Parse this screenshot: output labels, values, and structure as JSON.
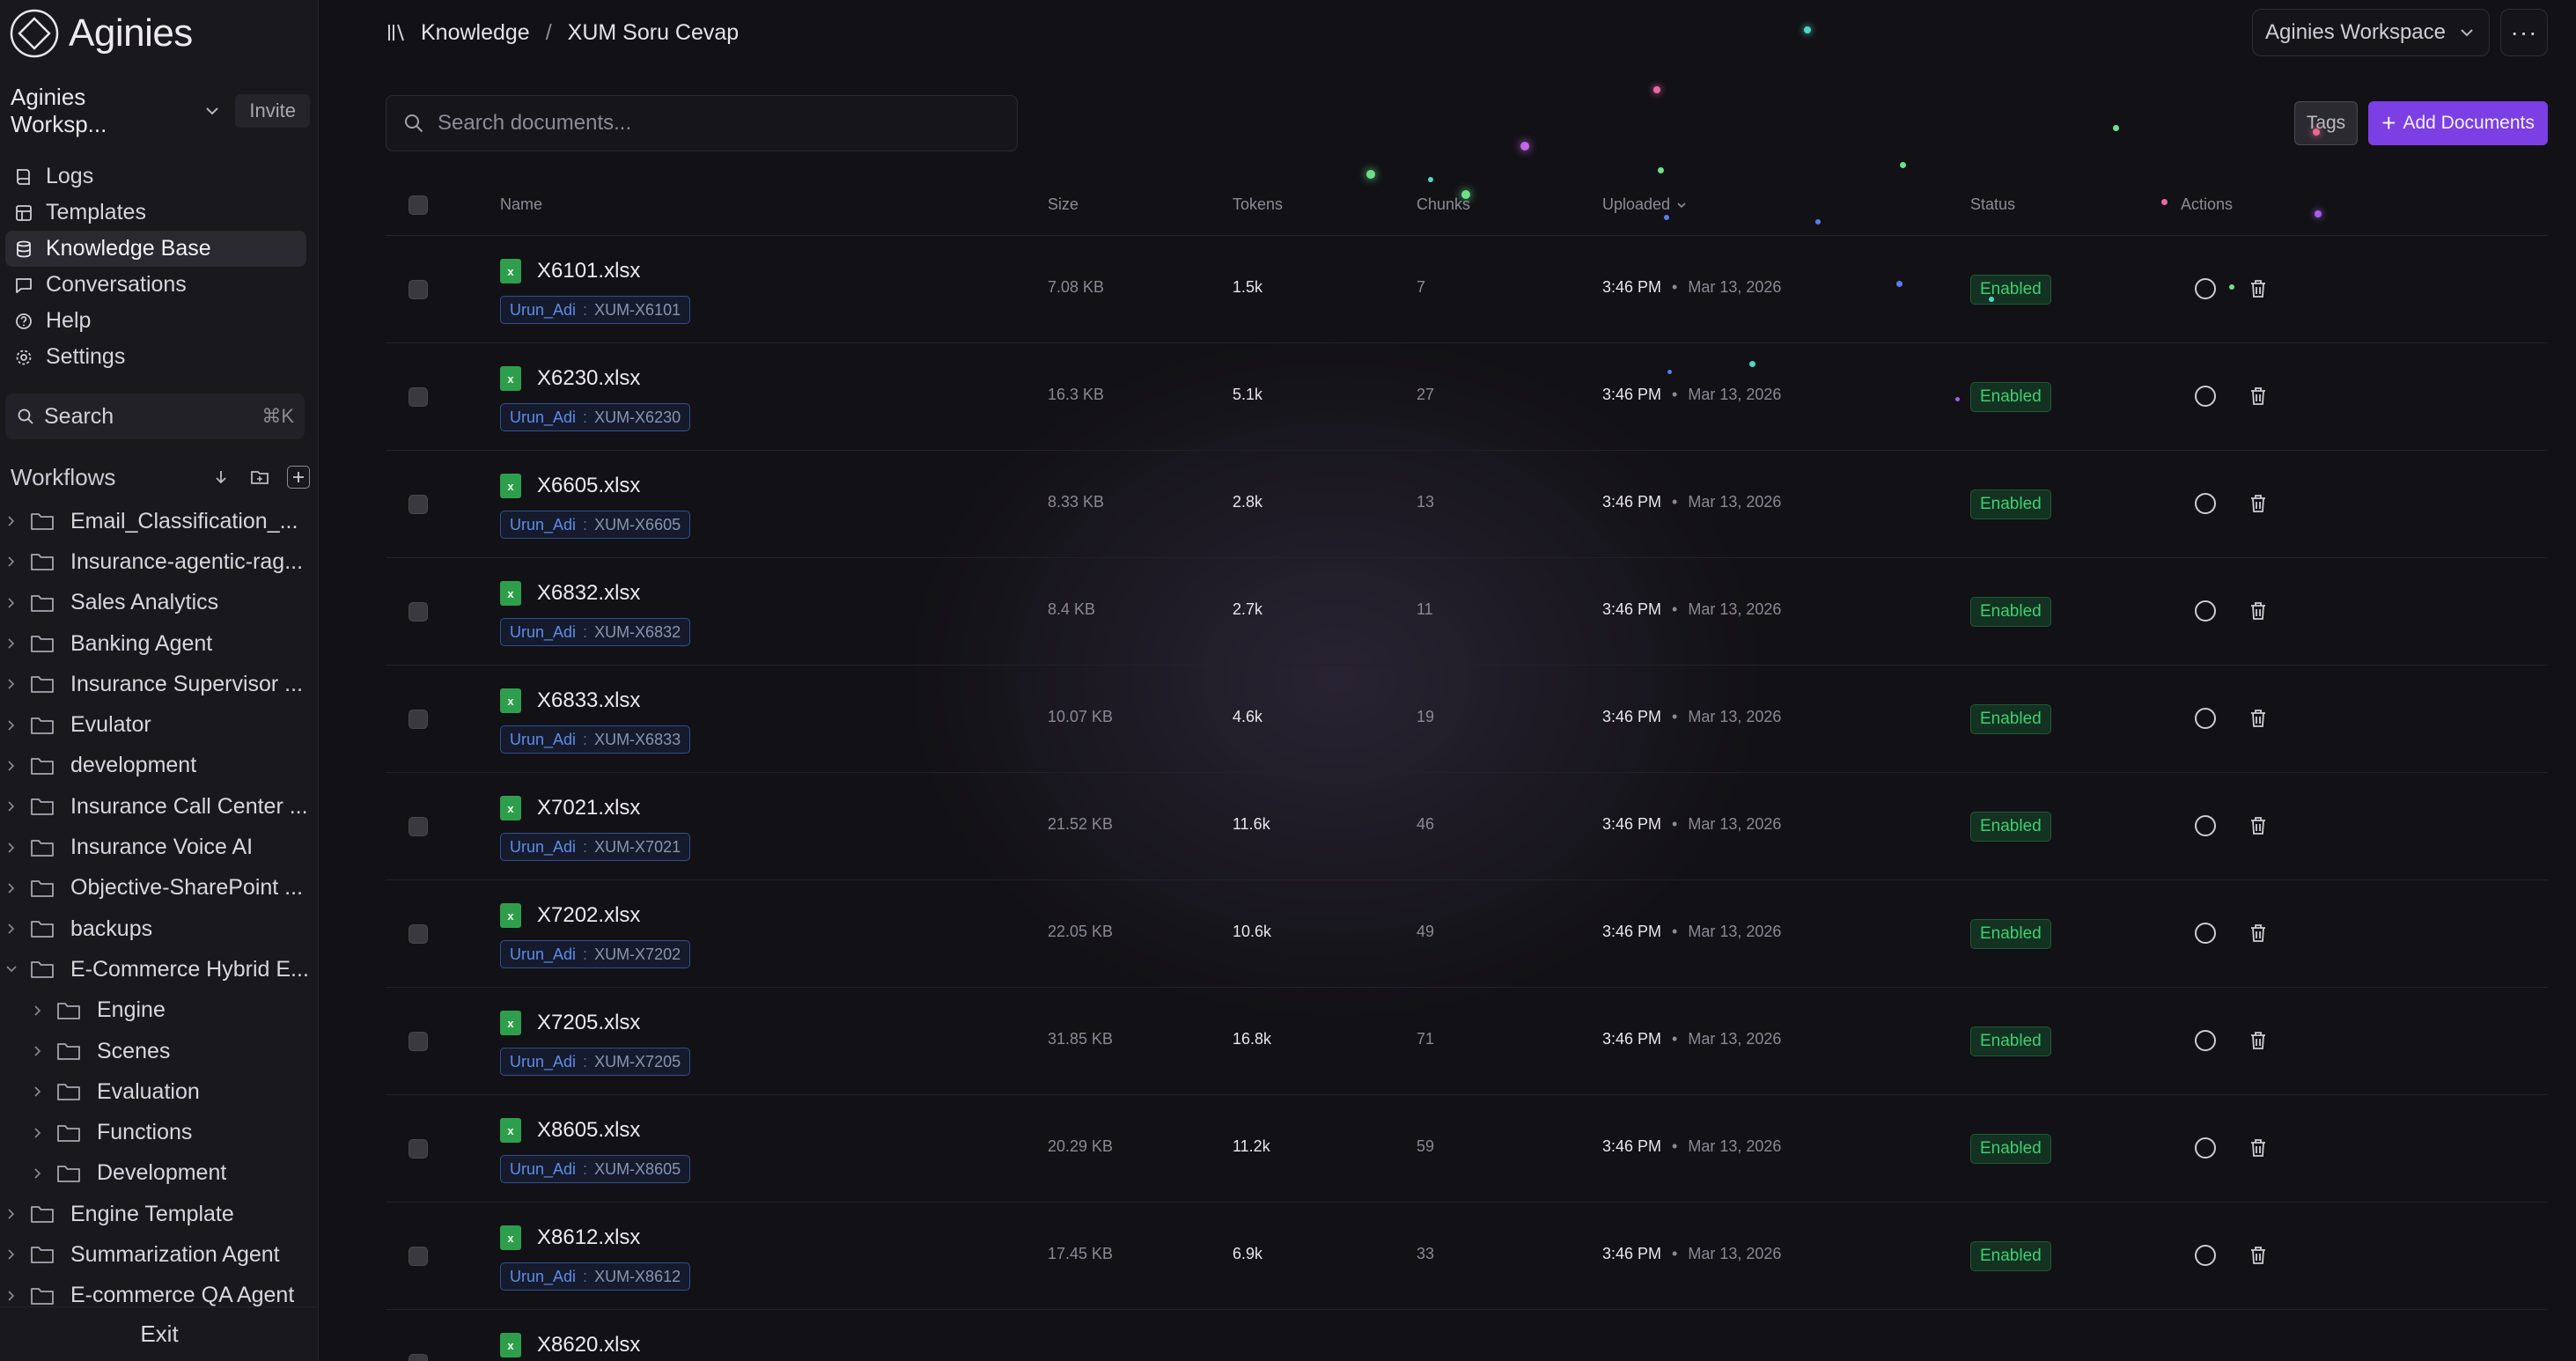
{
  "app": {
    "name": "Aginies"
  },
  "sidebar": {
    "workspace": "Aginies Worksp...",
    "invite_label": "Invite",
    "nav": [
      {
        "label": "Logs",
        "icon": "book-icon"
      },
      {
        "label": "Templates",
        "icon": "layout-icon"
      },
      {
        "label": "Knowledge Base",
        "icon": "database-icon",
        "active": true
      },
      {
        "label": "Conversations",
        "icon": "message-icon"
      },
      {
        "label": "Help",
        "icon": "help-circle-icon"
      },
      {
        "label": "Settings",
        "icon": "gear-icon"
      }
    ],
    "search_label": "Search",
    "search_shortcut": "⌘K",
    "workflows_title": "Workflows",
    "tree": [
      {
        "label": "Email_Classification_..."
      },
      {
        "label": "Insurance-agentic-rag..."
      },
      {
        "label": "Sales Analytics"
      },
      {
        "label": "Banking Agent"
      },
      {
        "label": "Insurance Supervisor ..."
      },
      {
        "label": "Evulator"
      },
      {
        "label": "development"
      },
      {
        "label": "Insurance Call Center ..."
      },
      {
        "label": "Insurance Voice AI"
      },
      {
        "label": "Objective-SharePoint ..."
      },
      {
        "label": "backups"
      },
      {
        "label": "E-Commerce Hybrid E...",
        "open": true
      },
      {
        "label": "Engine",
        "child": true
      },
      {
        "label": "Scenes",
        "child": true
      },
      {
        "label": "Evaluation",
        "child": true
      },
      {
        "label": "Functions",
        "child": true
      },
      {
        "label": "Development",
        "child": true
      },
      {
        "label": "Engine Template"
      },
      {
        "label": "Summarization Agent"
      },
      {
        "label": "E-commerce QA Agent"
      }
    ],
    "exit_label": "Exit"
  },
  "header": {
    "breadcrumb_root": "Knowledge",
    "breadcrumb_sep": "/",
    "breadcrumb_current": "XUM Soru Cevap",
    "workspace_select": "Aginies Workspace",
    "more_label": "···"
  },
  "toolbar": {
    "search_placeholder": "Search documents...",
    "tags_label": "Tags",
    "add_label": "Add Documents"
  },
  "table": {
    "columns": {
      "name": "Name",
      "size": "Size",
      "tokens": "Tokens",
      "chunks": "Chunks",
      "uploaded": "Uploaded",
      "status": "Status",
      "actions": "Actions"
    },
    "rows": [
      {
        "name": "X6101.xlsx",
        "tag_key": "Urun_Adi",
        "tag_value": "XUM-X6101",
        "size": "7.08 KB",
        "tokens": "1.5k",
        "chunks": "7",
        "time": "3:46 PM",
        "date": "Mar 13, 2026",
        "status": "Enabled"
      },
      {
        "name": "X6230.xlsx",
        "tag_key": "Urun_Adi",
        "tag_value": "XUM-X6230",
        "size": "16.3 KB",
        "tokens": "5.1k",
        "chunks": "27",
        "time": "3:46 PM",
        "date": "Mar 13, 2026",
        "status": "Enabled"
      },
      {
        "name": "X6605.xlsx",
        "tag_key": "Urun_Adi",
        "tag_value": "XUM-X6605",
        "size": "8.33 KB",
        "tokens": "2.8k",
        "chunks": "13",
        "time": "3:46 PM",
        "date": "Mar 13, 2026",
        "status": "Enabled"
      },
      {
        "name": "X6832.xlsx",
        "tag_key": "Urun_Adi",
        "tag_value": "XUM-X6832",
        "size": "8.4 KB",
        "tokens": "2.7k",
        "chunks": "11",
        "time": "3:46 PM",
        "date": "Mar 13, 2026",
        "status": "Enabled"
      },
      {
        "name": "X6833.xlsx",
        "tag_key": "Urun_Adi",
        "tag_value": "XUM-X6833",
        "size": "10.07 KB",
        "tokens": "4.6k",
        "chunks": "19",
        "time": "3:46 PM",
        "date": "Mar 13, 2026",
        "status": "Enabled"
      },
      {
        "name": "X7021.xlsx",
        "tag_key": "Urun_Adi",
        "tag_value": "XUM-X7021",
        "size": "21.52 KB",
        "tokens": "11.6k",
        "chunks": "46",
        "time": "3:46 PM",
        "date": "Mar 13, 2026",
        "status": "Enabled"
      },
      {
        "name": "X7202.xlsx",
        "tag_key": "Urun_Adi",
        "tag_value": "XUM-X7202",
        "size": "22.05 KB",
        "tokens": "10.6k",
        "chunks": "49",
        "time": "3:46 PM",
        "date": "Mar 13, 2026",
        "status": "Enabled"
      },
      {
        "name": "X7205.xlsx",
        "tag_key": "Urun_Adi",
        "tag_value": "XUM-X7205",
        "size": "31.85 KB",
        "tokens": "16.8k",
        "chunks": "71",
        "time": "3:46 PM",
        "date": "Mar 13, 2026",
        "status": "Enabled"
      },
      {
        "name": "X8605.xlsx",
        "tag_key": "Urun_Adi",
        "tag_value": "XUM-X8605",
        "size": "20.29 KB",
        "tokens": "11.2k",
        "chunks": "59",
        "time": "3:46 PM",
        "date": "Mar 13, 2026",
        "status": "Enabled"
      },
      {
        "name": "X8612.xlsx",
        "tag_key": "Urun_Adi",
        "tag_value": "XUM-X8612",
        "size": "17.45 KB",
        "tokens": "6.9k",
        "chunks": "33",
        "time": "3:46 PM",
        "date": "Mar 13, 2026",
        "status": "Enabled"
      },
      {
        "name": "X8620.xlsx",
        "tag_key": "",
        "tag_value": "",
        "size": "",
        "tokens": "",
        "chunks": "",
        "time": "",
        "date": "",
        "status": ""
      }
    ]
  },
  "colors": {
    "accent": "#7b3fe4",
    "enabled": "#3fcf6f",
    "tag": "#5d8ce8",
    "excel": "#2f9e4c"
  }
}
